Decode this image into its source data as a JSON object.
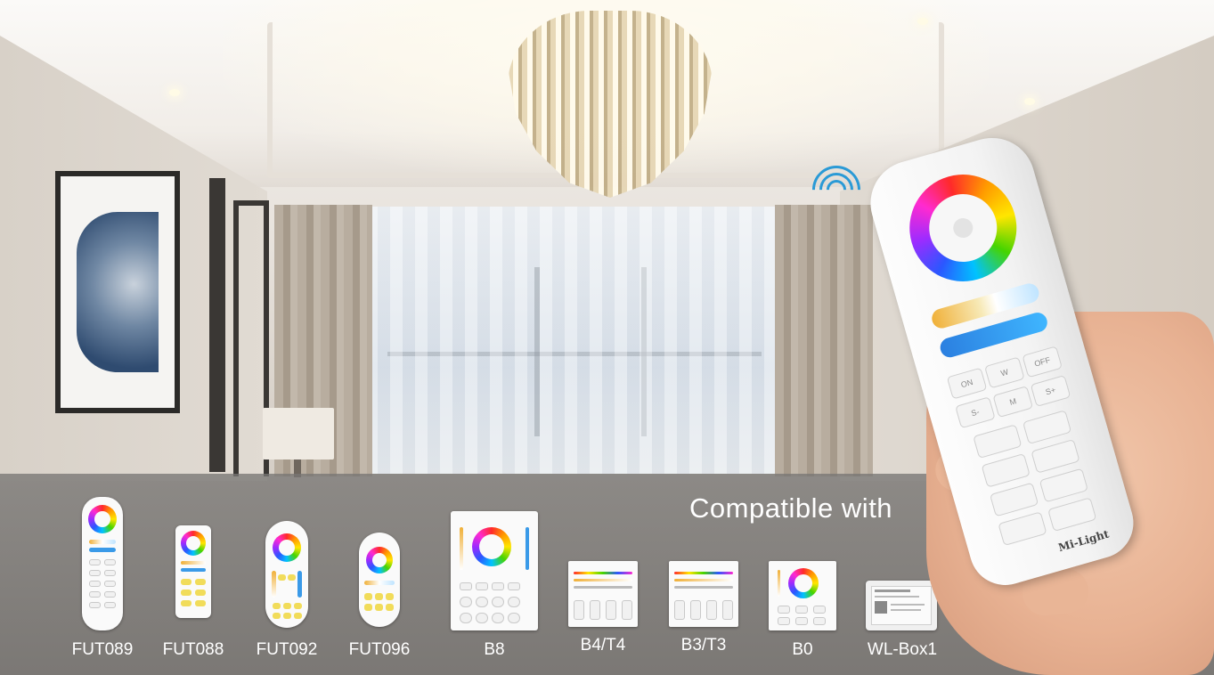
{
  "headline": "",
  "compatible_title": "Compatible with",
  "remote_brand": "Mi-Light",
  "remote_keys": [
    "ON",
    "W",
    "OFF",
    "S-",
    "M",
    "S+"
  ],
  "devices": [
    {
      "name": "FUT089"
    },
    {
      "name": "FUT088"
    },
    {
      "name": "FUT092"
    },
    {
      "name": "FUT096"
    },
    {
      "name": "B8"
    },
    {
      "name": "B4/T4"
    },
    {
      "name": "B3/T3"
    },
    {
      "name": "B0"
    },
    {
      "name": "WL-Box1"
    }
  ]
}
